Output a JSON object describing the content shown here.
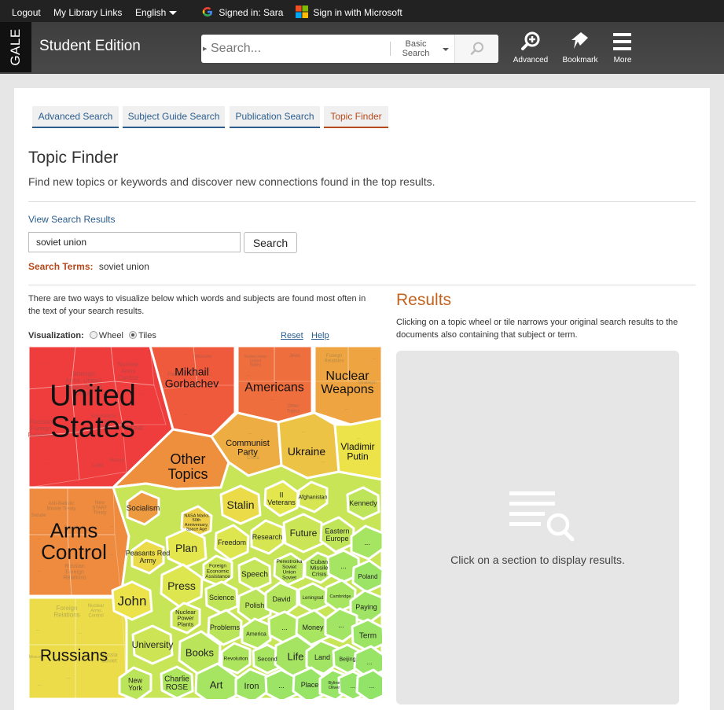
{
  "topbar": {
    "logout": "Logout",
    "library_links": "My Library Links",
    "language": "English",
    "google_signin": "Signed in: Sara",
    "microsoft_signin": "Sign in with Microsoft"
  },
  "header": {
    "logo": "GALE",
    "product": "Student Edition",
    "search_placeholder": "Search...",
    "search_mode_line1": "Basic",
    "search_mode_line2": "Search",
    "buttons": {
      "advanced": "Advanced",
      "bookmark": "Bookmark",
      "more": "More"
    }
  },
  "tabs": [
    {
      "label": "Advanced Search",
      "active": false
    },
    {
      "label": "Subject Guide Search",
      "active": false
    },
    {
      "label": "Publication Search",
      "active": false
    },
    {
      "label": "Topic Finder",
      "active": true
    }
  ],
  "page": {
    "title": "Topic Finder",
    "subtitle": "Find new topics or keywords and discover new connections found in the top results.",
    "view_results_link": "View Search Results",
    "search_value": "soviet union",
    "search_button": "Search",
    "search_terms_label": "Search Terms:",
    "search_terms_value": "soviet union",
    "intro": "There are two ways to visualize below which words and subjects are found most often in the text of your search results.",
    "visualization_label": "Visualization:",
    "option_wheel": "Wheel",
    "option_tiles": "Tiles",
    "selected_option": "Tiles",
    "reset": "Reset",
    "help": "Help"
  },
  "results": {
    "heading": "Results",
    "description": "Clicking on a topic wheel or tile narrows your original search results to the documents also containing that subject or term.",
    "empty_message": "Click on a section to display results."
  },
  "colors": {
    "red": "#ef3d3d",
    "orange": "#ee8f3e",
    "yellow": "#ece64a",
    "green": "#8fe46a",
    "link": "#2a5d8e",
    "accent": "#b5491c"
  },
  "treemap": {
    "major": [
      {
        "label": "United States",
        "sub": [
          "Strategic Arms, United States-Soviet Union",
          "Nuclear Arms Control",
          "Russian Foreign Relations",
          "Anti-Ballistic Missile Treaty",
          "Threat",
          "Cold",
          "History",
          "New START Treaty"
        ]
      },
      {
        "label": "Mikhail Gorbachev",
        "sub": [
          "Moscow",
          "Parties"
        ]
      },
      {
        "label": "Americans",
        "sub": [
          "Soviet Union United States",
          "Jews",
          "Other Topics"
        ]
      },
      {
        "label": "Nuclear Weapons",
        "sub": [
          "Foreign Relations",
          "Strategic"
        ]
      },
      {
        "label": "Other Topics",
        "sub": []
      },
      {
        "label": "Communist Party",
        "sub": [
          "China"
        ]
      },
      {
        "label": "Ukraine",
        "sub": []
      },
      {
        "label": "Vladimir Putin",
        "sub": []
      },
      {
        "label": "Arms Control",
        "sub": [
          "Anti-Ballistic Missile Treaty",
          "New START Treaty",
          "Senate",
          "President",
          "Russian Foreign Relations",
          "Crisis"
        ]
      },
      {
        "label": "Russians",
        "sub": [
          "Foreign Relations",
          "Nuclear Arms Control",
          "Moscow",
          "Russia Soviet"
        ]
      }
    ],
    "minor": [
      "Socialism",
      "Stalin",
      "II Veterans",
      "Afghanistan",
      "Kennedy",
      "NASA Marks 50th Anniversary, Space Age",
      "Peasants Red Army",
      "Plan",
      "Freedom",
      "Research",
      "Future",
      "Eastern Europe",
      "John",
      "Press",
      "Foreign Economic Assistance",
      "Speech",
      "Perestroika Soviet Union Soviet",
      "Cuban Missile Crisis",
      "Poland",
      "Nuclear Power Plants",
      "Science",
      "Polish",
      "David",
      "Leningrad",
      "Cambridge",
      "Paying",
      "University",
      "Problems",
      "America",
      "Money",
      "Term",
      "Books",
      "Revolution",
      "Second",
      "Life",
      "Land",
      "Beijing",
      "New York",
      "Charlie ROSE",
      "Art",
      "Iron",
      "Place",
      "Byline Oliver"
    ]
  }
}
